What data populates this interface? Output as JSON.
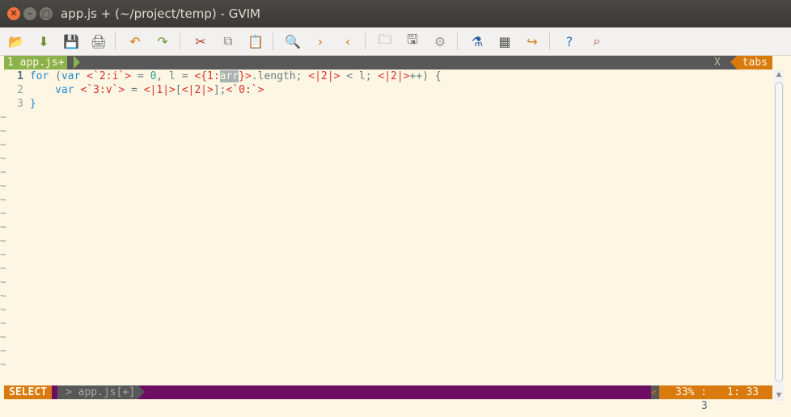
{
  "window": {
    "title": "app.js + (~/project/temp) - GVIM",
    "close_glyph": "✕",
    "min_glyph": "–",
    "max_glyph": "□"
  },
  "toolbar": [
    {
      "name": "open-file-icon",
      "glyph": "📂",
      "color": "#d9822b"
    },
    {
      "name": "save-download-icon",
      "glyph": "⬇",
      "color": "#6a8e2e"
    },
    {
      "name": "save-icon",
      "glyph": "💾",
      "color": "#555"
    },
    {
      "name": "print-icon",
      "glyph": "🖨",
      "color": "#666"
    },
    {
      "name": "undo-icon",
      "glyph": "↶",
      "color": "#d97a0f"
    },
    {
      "name": "redo-icon",
      "glyph": "↷",
      "color": "#6a9a2e"
    },
    {
      "name": "cut-icon",
      "glyph": "✂",
      "color": "#c0392b"
    },
    {
      "name": "copy-icon",
      "glyph": "⧉",
      "color": "#888"
    },
    {
      "name": "paste-icon",
      "glyph": "📋",
      "color": "#8a6d3b"
    },
    {
      "name": "find-replace-icon",
      "glyph": "🔍",
      "color": "#2c5f9e"
    },
    {
      "name": "find-next-icon",
      "glyph": "›",
      "color": "#d97a0f"
    },
    {
      "name": "find-previous-icon",
      "glyph": "‹",
      "color": "#d97a0f"
    },
    {
      "name": "load-session-icon",
      "glyph": "🗀",
      "color": "#666"
    },
    {
      "name": "save-session-icon",
      "glyph": "🖫",
      "color": "#666"
    },
    {
      "name": "run-script-icon",
      "glyph": "⚙",
      "color": "#999"
    },
    {
      "name": "make-icon",
      "glyph": "⚗",
      "color": "#2c5f9e"
    },
    {
      "name": "ctags-icon",
      "glyph": "▦",
      "color": "#555"
    },
    {
      "name": "jump-tag-icon",
      "glyph": "↪",
      "color": "#d97a0f"
    },
    {
      "name": "help-icon",
      "glyph": "?",
      "color": "#2c6fbf"
    },
    {
      "name": "find-help-icon",
      "glyph": "⌕",
      "color": "#c0392b"
    }
  ],
  "tabline": {
    "active_tab": "1 app.js+",
    "close_label": "X",
    "tabs_label": "tabs"
  },
  "buffer": {
    "lines": [
      {
        "number": "1",
        "current": true,
        "segments": [
          {
            "t": "for",
            "c": "kw"
          },
          {
            "t": " (",
            "c": "plain"
          },
          {
            "t": "var",
            "c": "kw"
          },
          {
            "t": " ",
            "c": "plain"
          },
          {
            "t": "<`2:i`>",
            "c": "ph"
          },
          {
            "t": " = ",
            "c": "plain"
          },
          {
            "t": "0",
            "c": "num"
          },
          {
            "t": ", l = ",
            "c": "plain"
          },
          {
            "t": "<{1:",
            "c": "ph"
          },
          {
            "t": "arr",
            "c": "sel"
          },
          {
            "t": "}>",
            "c": "ph"
          },
          {
            "t": ".length; ",
            "c": "plain"
          },
          {
            "t": "<|2|>",
            "c": "ph"
          },
          {
            "t": " < l; ",
            "c": "plain"
          },
          {
            "t": "<|2|>",
            "c": "ph"
          },
          {
            "t": "++) {",
            "c": "plain"
          }
        ]
      },
      {
        "number": "2",
        "current": false,
        "segments": [
          {
            "t": "    ",
            "c": "plain"
          },
          {
            "t": "var",
            "c": "kw"
          },
          {
            "t": " ",
            "c": "plain"
          },
          {
            "t": "<`3:v`>",
            "c": "ph"
          },
          {
            "t": " = ",
            "c": "plain"
          },
          {
            "t": "<|1|>",
            "c": "ph"
          },
          {
            "t": "[",
            "c": "plain"
          },
          {
            "t": "<|2|>",
            "c": "ph"
          },
          {
            "t": "];",
            "c": "plain"
          },
          {
            "t": "<`0:`>",
            "c": "ph"
          }
        ]
      },
      {
        "number": "3",
        "current": false,
        "segments": [
          {
            "t": "}",
            "c": "kw"
          }
        ]
      }
    ],
    "tilde": "~",
    "tilde_count": 19
  },
  "statusline": {
    "mode": "SELECT",
    "file": "> app.js[+]",
    "left_arrow": "<",
    "percent": "33% :",
    "position": "1: 33"
  },
  "cmdline": {
    "count": "3"
  },
  "scrollbar": {
    "up": "▲",
    "down": "▼"
  }
}
